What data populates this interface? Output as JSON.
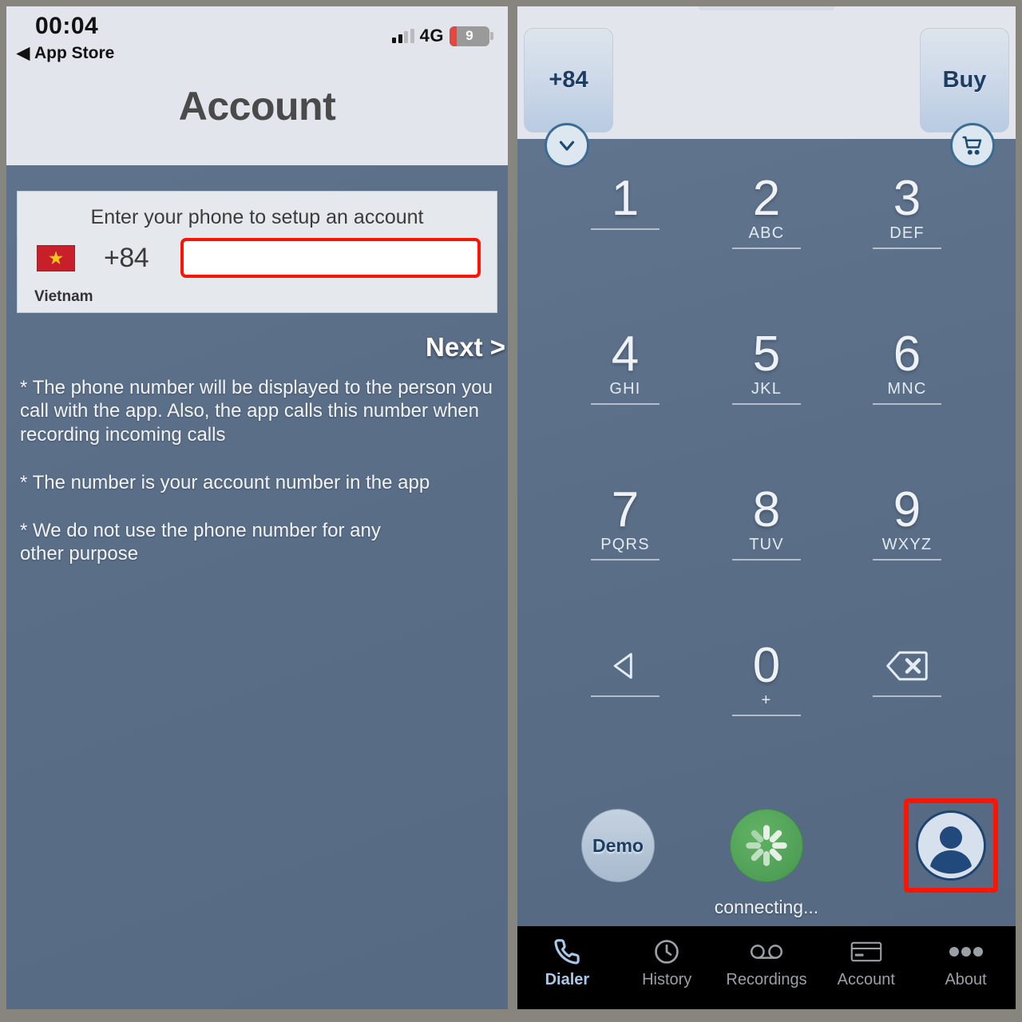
{
  "left": {
    "status": {
      "time": "00:04",
      "back_label": "App Store",
      "network": "4G",
      "battery_level": "9"
    },
    "title": "Account",
    "card": {
      "prompt": "Enter your phone to setup an account",
      "flag_icon": "vietnam-flag-icon",
      "country_code": "+84",
      "country_name": "Vietnam",
      "phone_value": "",
      "phone_placeholder": ""
    },
    "next_label": "Next >",
    "notes": [
      "* The phone number will be displayed to the person you call with the app. Also, the app calls this number when recording incoming calls",
      "* The number is your account number in the app",
      "* We do not use the phone number for any\nother purpose"
    ]
  },
  "right": {
    "topbar": {
      "country_code_label": "+84",
      "buy_label": "Buy"
    },
    "circle_buttons": {
      "chevron": "chevron-down-icon",
      "cart": "shopping-cart-icon"
    },
    "keypad": [
      {
        "digit": "1",
        "letters": ""
      },
      {
        "digit": "2",
        "letters": "ABC"
      },
      {
        "digit": "3",
        "letters": "DEF"
      },
      {
        "digit": "4",
        "letters": "GHI"
      },
      {
        "digit": "5",
        "letters": "JKL"
      },
      {
        "digit": "6",
        "letters": "MNC"
      },
      {
        "digit": "7",
        "letters": "PQRS"
      },
      {
        "digit": "8",
        "letters": "TUV"
      },
      {
        "digit": "9",
        "letters": "WXYZ"
      },
      {
        "digit": "",
        "letters": ""
      },
      {
        "digit": "0",
        "letters": "+"
      },
      {
        "digit": "",
        "letters": ""
      }
    ],
    "actions": {
      "demo_label": "Demo",
      "call_icon": "spinner-icon",
      "status_text": "connecting...",
      "account_icon": "user-avatar-icon"
    },
    "tabs": [
      {
        "label": "Dialer",
        "icon": "phone-icon",
        "active": true
      },
      {
        "label": "History",
        "icon": "clock-icon",
        "active": false
      },
      {
        "label": "Recordings",
        "icon": "voicemail-icon",
        "active": false
      },
      {
        "label": "Account",
        "icon": "card-icon",
        "active": false
      },
      {
        "label": "About",
        "icon": "ellipsis-icon",
        "active": false
      }
    ]
  },
  "colors": {
    "highlight": "#fc1405",
    "accent_blue": "#1d3e63",
    "green": "#4f9f57",
    "panel_bg": "#5b6f89"
  }
}
